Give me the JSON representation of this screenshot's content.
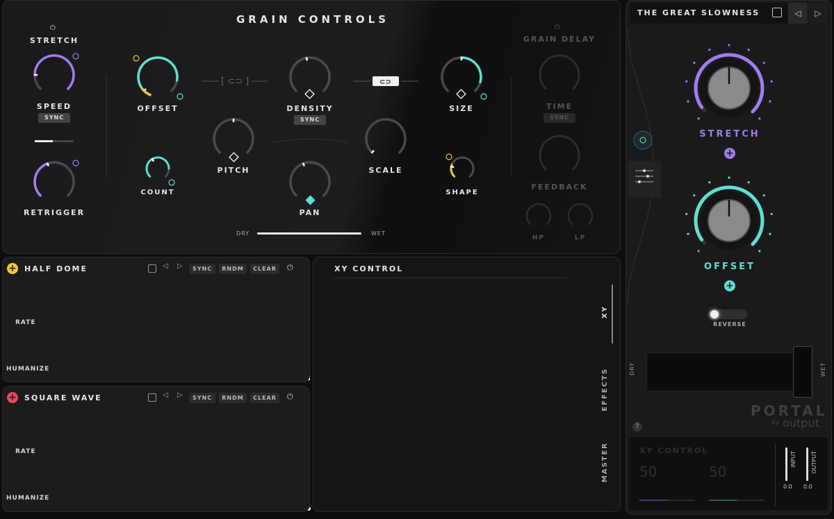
{
  "grain": {
    "title": "GRAIN CONTROLS",
    "stretch": "STRETCH",
    "speed": "SPEED",
    "sync": "SYNC",
    "retrigger": "RETRIGGER",
    "offset": "OFFSET",
    "count": "COUNT",
    "density": "DENSITY",
    "pitch": "PITCH",
    "pan": "PAN",
    "size": "SIZE",
    "scale": "SCALE",
    "shape": "SHAPE",
    "dry": "DRY",
    "wet": "WET"
  },
  "grain_delay": {
    "title": "GRAIN DELAY",
    "time": "TIME",
    "sync": "SYNC",
    "feedback": "FEEDBACK",
    "hp": "HP",
    "lp": "LP"
  },
  "mod1": {
    "title": "HALF DOME",
    "buttons": [
      "SYNC",
      "RNDM",
      "CLEAR"
    ],
    "rate": "RATE",
    "humanize": "HUMANIZE",
    "color": "#f0c93a"
  },
  "mod2": {
    "title": "SQUARE WAVE",
    "buttons": [
      "SYNC",
      "RNDM",
      "CLEAR"
    ],
    "rate": "RATE",
    "humanize": "HUMANIZE",
    "color": "#e8485e"
  },
  "xy": {
    "title": "XY CONTROL",
    "tabs": [
      "XY",
      "EFFECTS",
      "MASTER"
    ]
  },
  "preset": {
    "name": "THE GREAT SLOWNESS"
  },
  "macros": {
    "stretch": "STRETCH",
    "offset": "OFFSET",
    "reverse": "REVERSE",
    "dry": "DRY",
    "wet": "WET",
    "stretch_color": "#a07cf0",
    "offset_color": "#5fe0d0"
  },
  "brand": {
    "name": "PORTAL",
    "by": "by",
    "maker": "output",
    "help": "?"
  },
  "footer": {
    "xy_title": "XY CONTROL",
    "x_val": "50",
    "y_val": "50",
    "input": "INPUT",
    "output": "OUTPUT",
    "in_val": "0.0",
    "out_val": "0.0"
  }
}
